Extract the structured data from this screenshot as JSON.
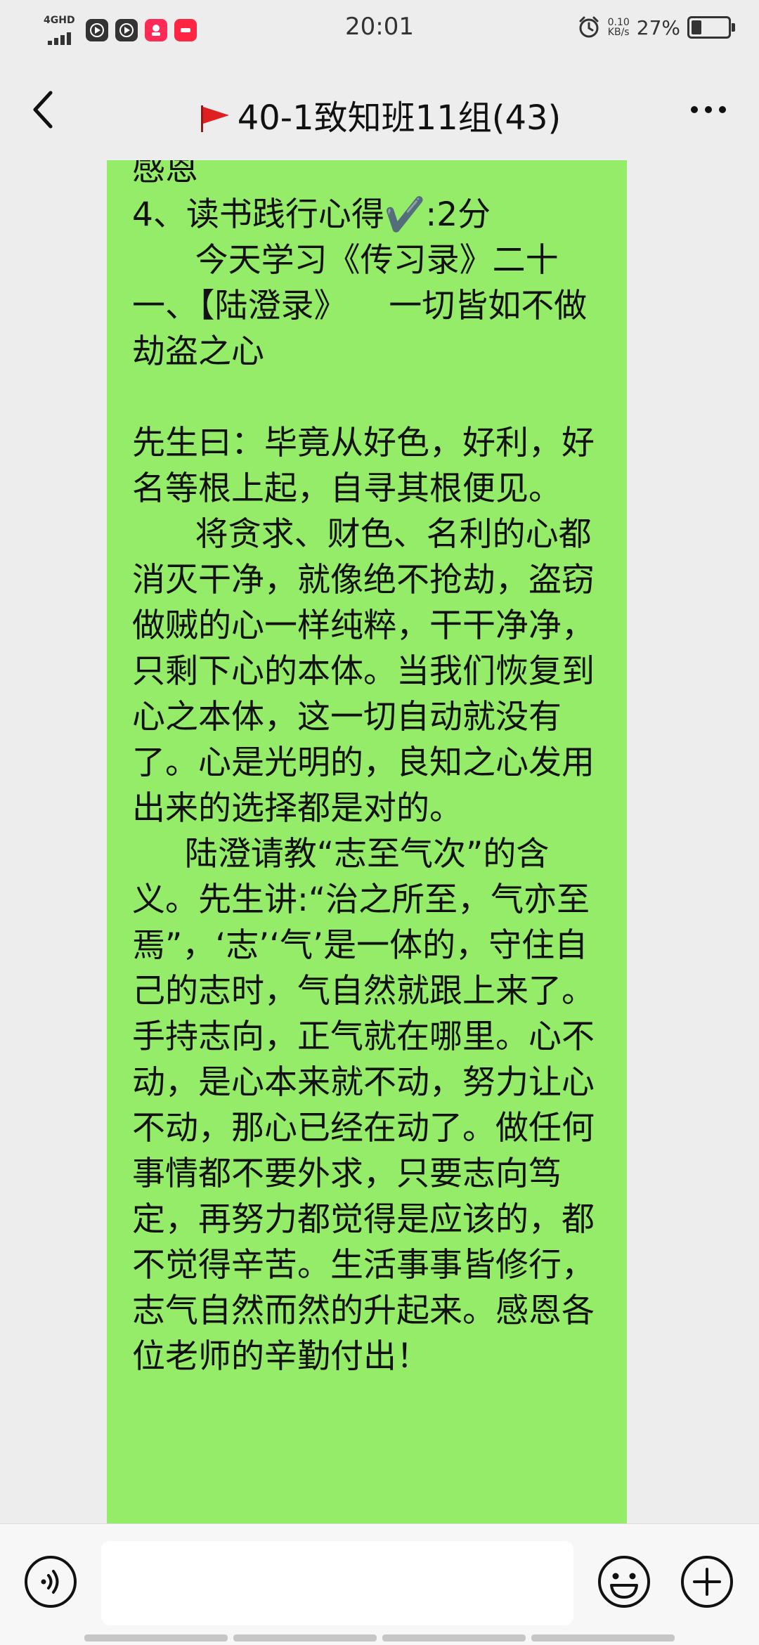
{
  "status_bar": {
    "network": "4GHD",
    "time": "20:01",
    "speed_value": "0.10",
    "speed_unit": "KB/s",
    "battery": "27%",
    "battery_level": 0.27,
    "app_badges": [
      "uc-icon",
      "uc-icon",
      "kuaishou-icon",
      "xiaohongshu-icon"
    ]
  },
  "nav": {
    "title": "40-1致知班11组(43)"
  },
  "message": {
    "text": "感恩\n4、读书践行心得✔️:2分\n      今天学习《传习录》二十一、【陆澄录》    一切皆如不做劫盗之心\n\n先生曰：毕竟从好色，好利，好名等根上起，自寻其根便见。\n      将贪求、财色、名利的心都消灭干净，就像绝不抢劫，盗窃做贼的心一样纯粹，干干净净，只剩下心的本体。当我们恢复到心之本体，这一切自动就没有了。心是光明的，良知之心发用出来的选择都是对的。\n     陆澄请教“志至气次”的含义。先生讲:“治之所至，气亦至焉”，‘志’‘气’是一体的，守住自己的志时，气自然就跟上来了。手持志向，正气就在哪里。心不动，是心本来就不动，努力让心不动，那心已经在动了。做任何事情都不要外求，只要志向笃定，再努力都觉得是应该的，都不觉得辛苦。生活事事皆修行，志气自然而然的升起来。感恩各位老师的辛勤付出！",
    "bubble_color": "#95ec69"
  },
  "input": {
    "value": ""
  }
}
